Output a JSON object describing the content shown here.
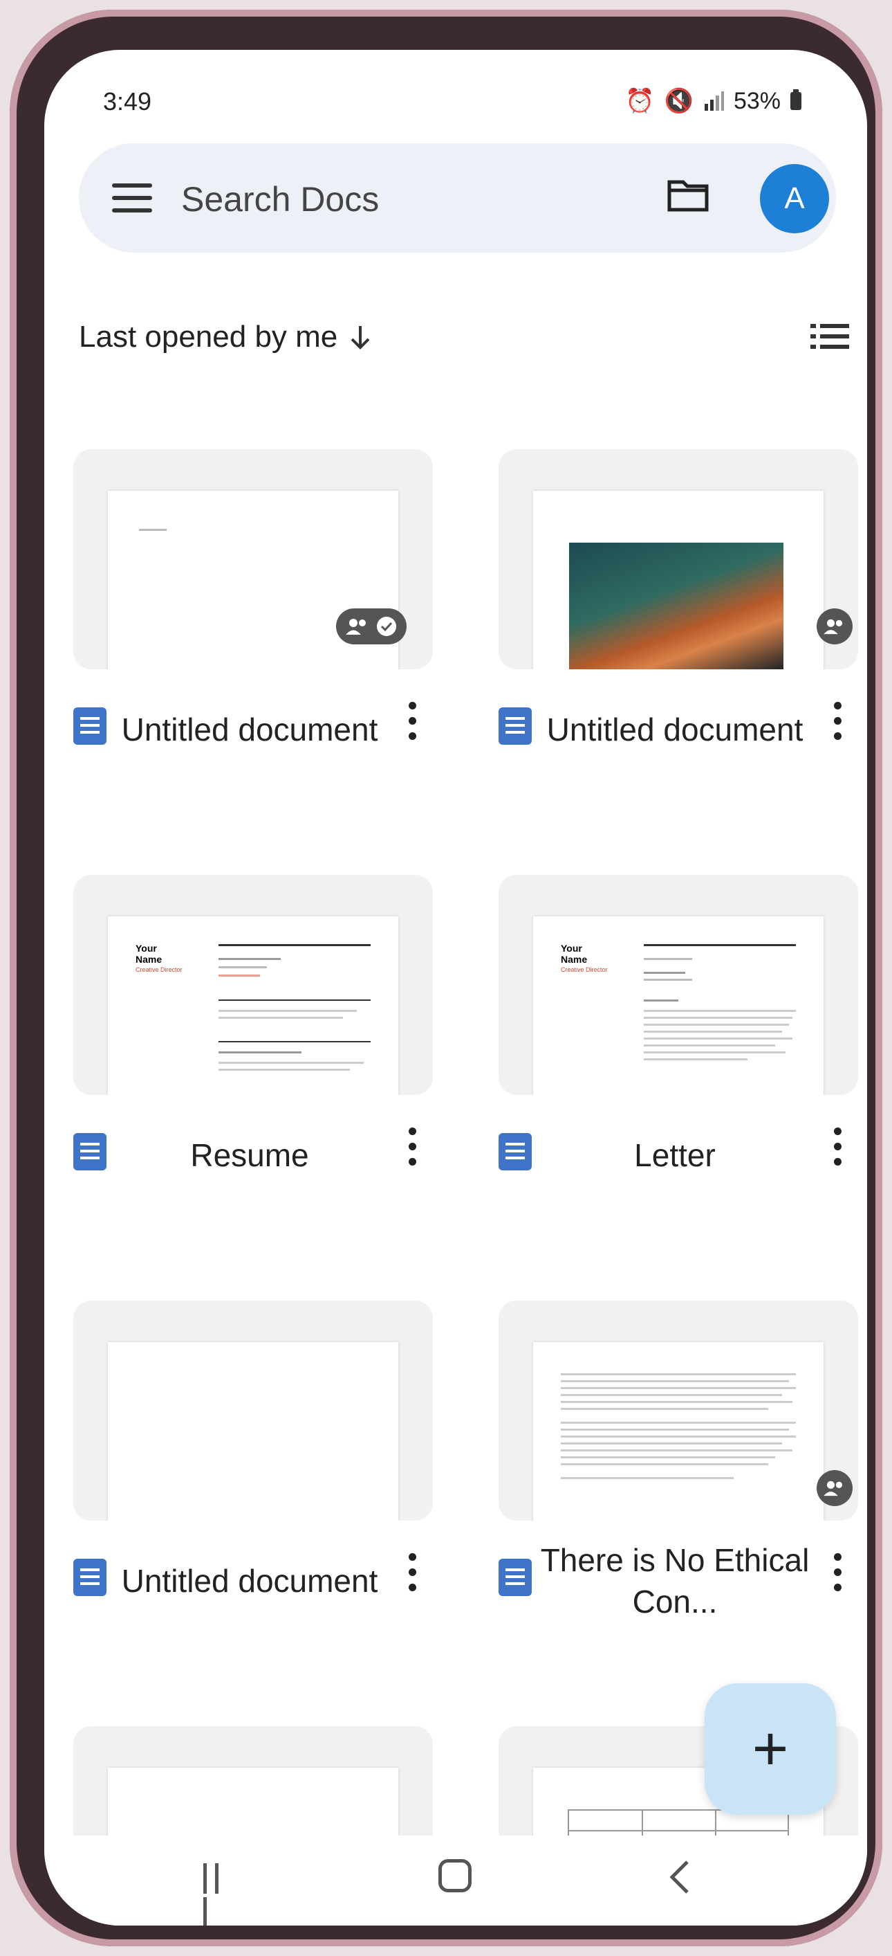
{
  "status": {
    "time": "3:49",
    "battery": "53%"
  },
  "search": {
    "placeholder": "Search Docs",
    "avatar_initial": "A"
  },
  "sort": {
    "label": "Last opened by me"
  },
  "docs": [
    {
      "title": "Untitled document"
    },
    {
      "title": "Untitled document"
    },
    {
      "title": "Resume"
    },
    {
      "title": "Letter"
    },
    {
      "title": "Untitled document"
    },
    {
      "title": "There is No Ethical Con..."
    }
  ],
  "resume_preview": {
    "name": "Your Name",
    "subtitle": "Creative Director"
  },
  "letter_preview": {
    "name": "Your Name",
    "subtitle": "Creative Director"
  },
  "fab": {
    "label": "+"
  },
  "colors": {
    "accent": "#1e7fd6",
    "doc_icon": "#3f74c8",
    "fab_bg": "#c9e4f7",
    "search_bg": "#edf0f6"
  }
}
